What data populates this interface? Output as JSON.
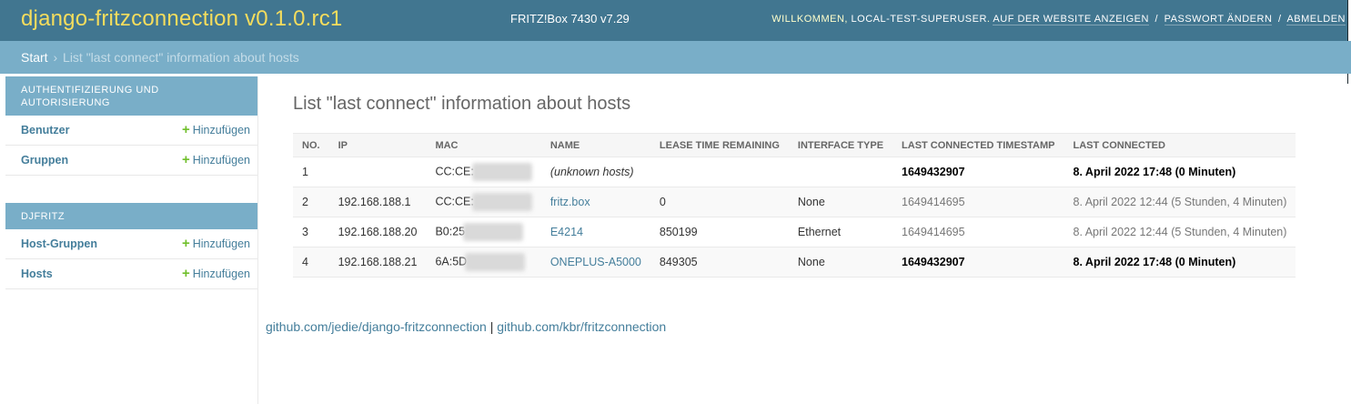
{
  "header": {
    "branding": "django-fritzconnection v0.1.0.rc1",
    "device": "FRITZ!Box 7430 v7.29",
    "welcome": "Willkommen,",
    "username": "local-test-superuser",
    "links": [
      "Auf der Website anzeigen",
      "Passwort ändern",
      "Abmelden"
    ],
    "separator": "/"
  },
  "breadcrumbs": {
    "start": "Start",
    "arrow": "›",
    "current": "List \"last connect\" information about hosts"
  },
  "sidebar": {
    "add_label": "Hinzufügen",
    "plus": "+",
    "modules": [
      {
        "caption": "Authentifizierung und Autorisierung",
        "models": [
          "Benutzer",
          "Gruppen"
        ]
      },
      {
        "caption": "DJFRITZ",
        "models": [
          "Host-Gruppen",
          "Hosts"
        ]
      }
    ]
  },
  "content": {
    "title": "List \"last connect\" information about hosts"
  },
  "table": {
    "headers": [
      "No.",
      "IP",
      "MAC",
      "Name",
      "Lease time remaining",
      "Interface type",
      "Last connected timestamp",
      "Last connected"
    ],
    "rows": [
      {
        "no": "1",
        "ip": "",
        "mac": "CC:CE:",
        "name": "(unknown hosts)",
        "lease": "",
        "interface": "",
        "timestamp": "1649432907",
        "connected": "8. April 2022 17:48 (0 Minuten)"
      },
      {
        "no": "2",
        "ip": "192.168.188.1",
        "mac": "CC:CE:",
        "name": "fritz.box",
        "lease": "0",
        "interface": "None",
        "timestamp": "1649414695",
        "connected": "8. April 2022 12:44 (5 Stunden, 4 Minuten)"
      },
      {
        "no": "3",
        "ip": "192.168.188.20",
        "mac": "B0:25",
        "name": "E4214",
        "lease": "850199",
        "interface": "Ethernet",
        "timestamp": "1649414695",
        "connected": "8. April 2022 12:44 (5 Stunden, 4 Minuten)"
      },
      {
        "no": "4",
        "ip": "192.168.188.21",
        "mac": "6A:5D",
        "name": "ONEPLUS-A5000",
        "lease": "849305",
        "interface": "None",
        "timestamp": "1649432907",
        "connected": "8. April 2022 17:48 (0 Minuten)"
      }
    ]
  },
  "footer": {
    "link1": "github.com/jedie/django-fritzconnection",
    "separator": "|",
    "link2": "github.com/kbr/fritzconnection"
  },
  "colors": {
    "header_bg": "#417690",
    "branding": "#f5dd5d",
    "breadcrumb_bg": "#79aec8",
    "link": "#447e9b",
    "add_plus": "#70bf2b"
  }
}
